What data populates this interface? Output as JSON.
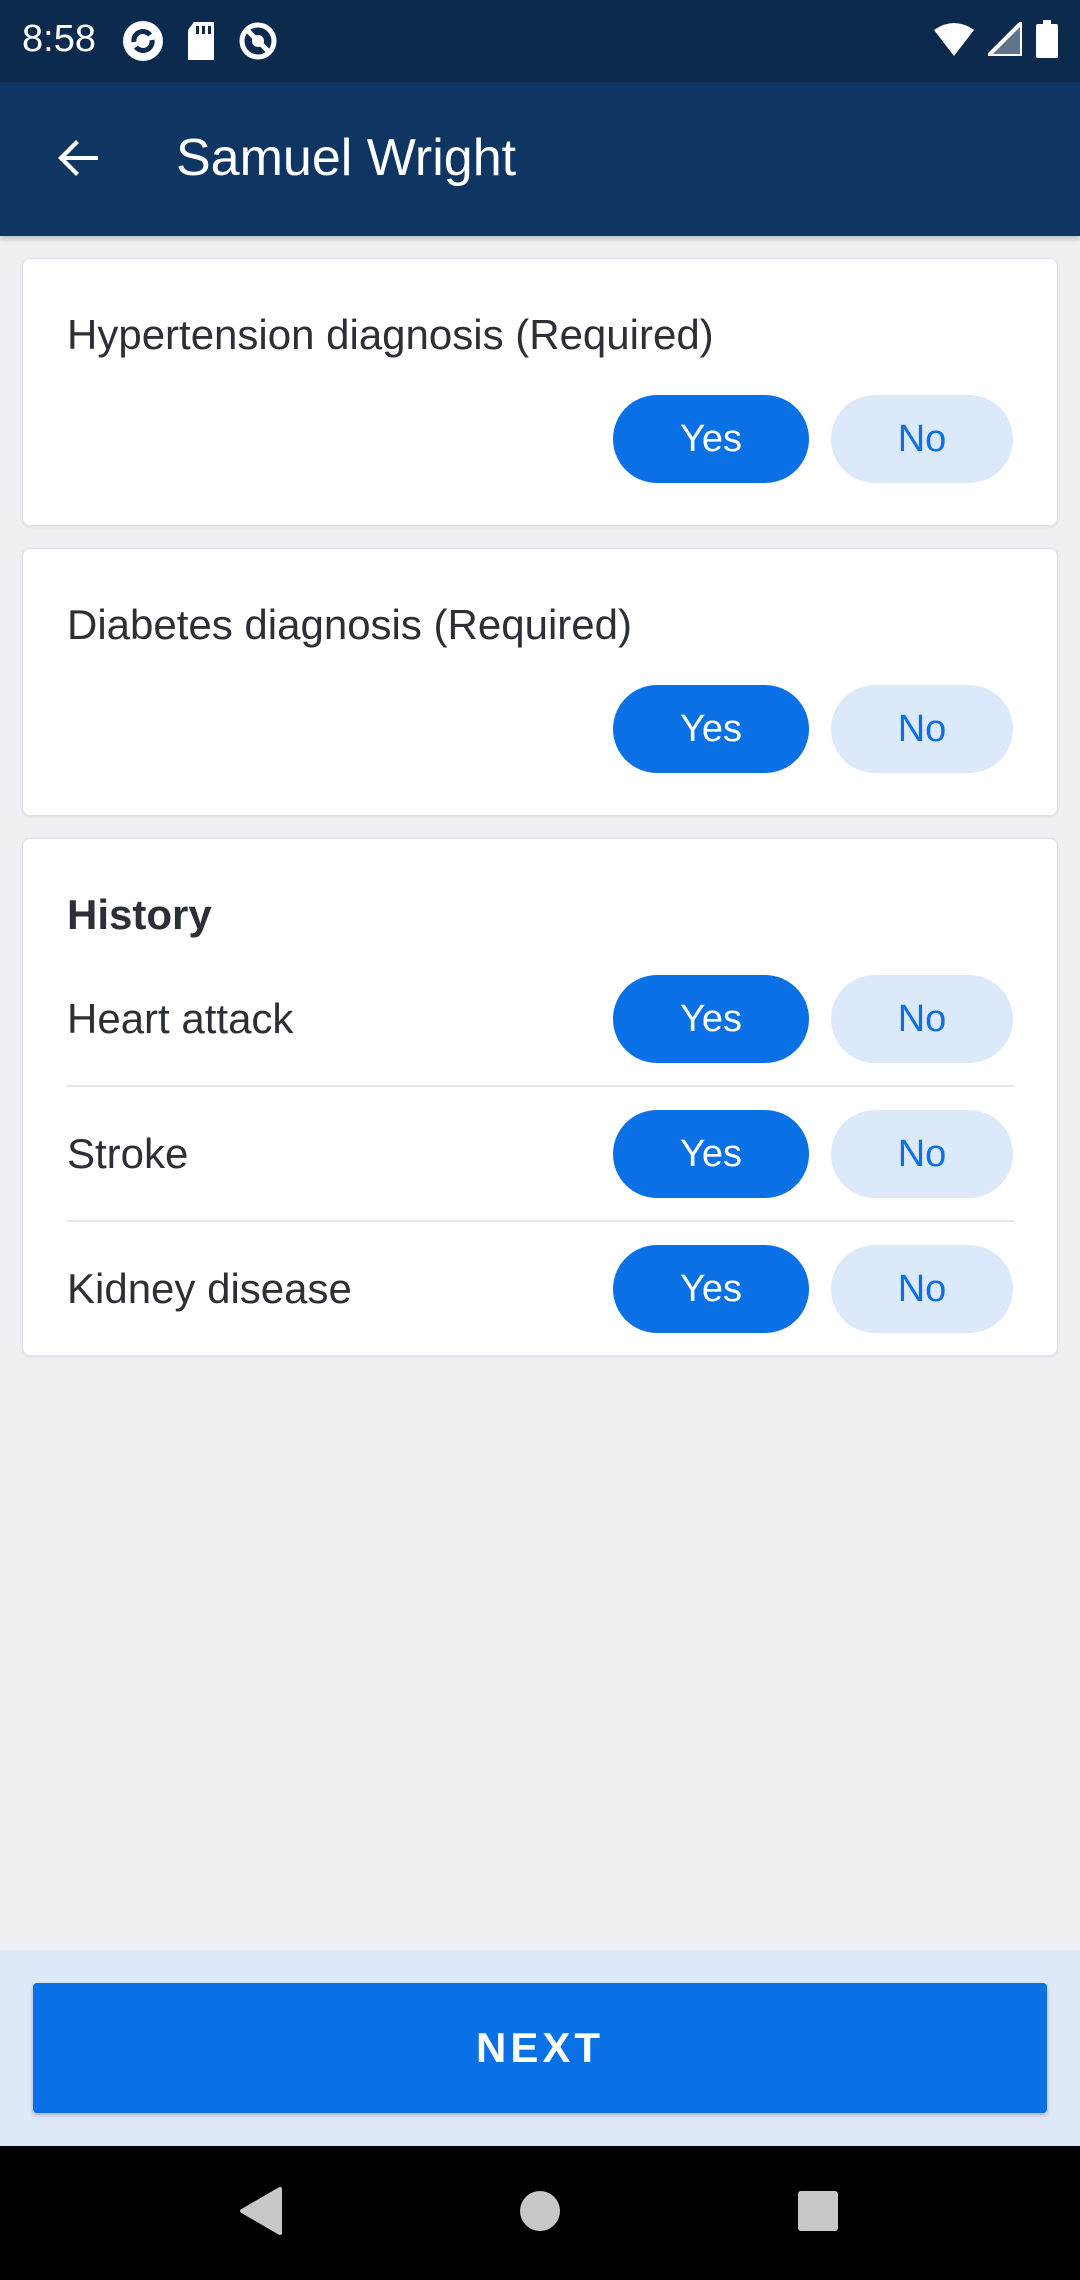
{
  "status_bar": {
    "time": "8:58",
    "left_icons": [
      "sync-icon",
      "sd-card-icon",
      "no-location-icon"
    ],
    "right_icons": [
      "wifi-icon",
      "signal-icon",
      "battery-icon"
    ]
  },
  "app_bar": {
    "title": "Samuel Wright",
    "back_icon": "arrow-back-icon"
  },
  "hypertension": {
    "title": "Hypertension diagnosis (Required)",
    "yes_label": "Yes",
    "no_label": "No"
  },
  "diabetes": {
    "title": "Diabetes diagnosis (Required)",
    "yes_label": "Yes",
    "no_label": "No"
  },
  "history": {
    "title": "History",
    "rows": [
      {
        "label": "Heart attack",
        "yes_label": "Yes",
        "no_label": "No"
      },
      {
        "label": "Stroke",
        "yes_label": "Yes",
        "no_label": "No"
      },
      {
        "label": "Kidney disease",
        "yes_label": "Yes",
        "no_label": "No"
      }
    ]
  },
  "footer": {
    "next_label": "NEXT"
  },
  "nav_bar": {
    "icons": [
      "back-triangle-icon",
      "home-circle-icon",
      "recents-square-icon"
    ]
  },
  "colors": {
    "status_bar_bg": "#0b2a4e",
    "app_bar_bg": "#0f3562",
    "accent": "#0a70e6",
    "pill_no_bg": "#dce9fb",
    "page_bg": "#eef0f4"
  }
}
